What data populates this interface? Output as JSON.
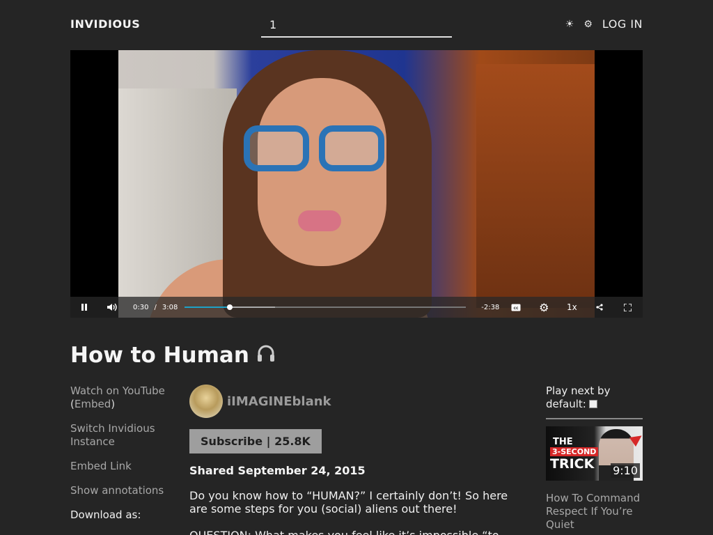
{
  "header": {
    "brand": "INVIDIOUS",
    "search_value": "1",
    "theme_icon": "sun-icon",
    "prefs_icon": "gear-icon",
    "login_label": "LOG IN"
  },
  "player": {
    "current_time": "0:30",
    "separator": "/",
    "duration": "3:08",
    "remaining": "-2:38",
    "progress_fraction": 0.16,
    "buffer_fraction": 0.32,
    "speed_label": "1x",
    "icons": [
      "pause-icon",
      "volume-icon",
      "captions-icon",
      "settings-icon",
      "share-icon",
      "fullscreen-icon"
    ],
    "accent_color": "#1ea1c7"
  },
  "video": {
    "title": "How to Human",
    "title_icon": "headphones-icon"
  },
  "sidebar_left": {
    "watch_on": "Watch on YouTube",
    "paren_open": " (",
    "embed": "Embed",
    "paren_close": ")",
    "switch_instance": "Switch Invidious Instance",
    "embed_link": "Embed Link",
    "show_annotations": "Show annotations",
    "download_as": "Download as:"
  },
  "channel": {
    "name": "iIMAGINEblank",
    "subscribe_label": "Subscribe | 25.8K",
    "shared": "Shared September 24, 2015"
  },
  "description": {
    "para1": "Do you know how to “HUMAN?” I certainly don’t! So here are some steps for you (social) aliens out there!",
    "para2": "QUESTION: What makes you feel like it’s impossible “to"
  },
  "sidebar_right": {
    "play_next": "Play next by default:",
    "play_next_checked": false,
    "recommended": [
      {
        "thumb_line1": "THE",
        "thumb_line2": "3-SECOND",
        "thumb_line3": "TRICK",
        "duration": "9:10",
        "title": "How To Command Respect If You’re Quiet"
      }
    ]
  }
}
